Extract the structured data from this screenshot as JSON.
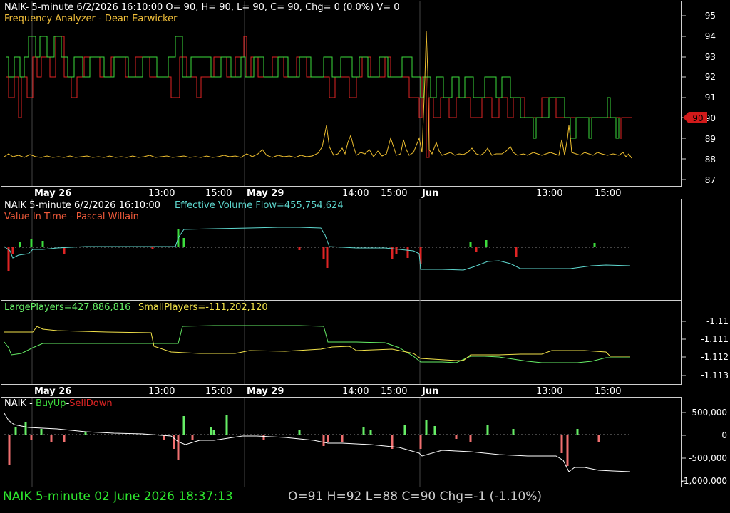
{
  "colors": {
    "background": "#000000",
    "frame": "#cfcfcf",
    "grid": "#3a3a3a",
    "axis_text": "#ffffff",
    "white": "#ffffff",
    "yellow": "#f2e24a",
    "orange_yellow": "#f0c030",
    "green": "#3ddc3d",
    "red": "#e02424",
    "cyan": "#5fd9d0",
    "light_green": "#66ee66",
    "salmon": "#f07070",
    "price_tag": "#d11a1a",
    "status_green": "#2ee62e",
    "status_gray": "#cfcfcf"
  },
  "panel1": {
    "header_line1": "NAIK- 5-minute 6/2/2026 16:10:00 O= 90, H= 90, L= 90, C= 90, Chg= 0 (0.0%) V= 0",
    "header_line2": "Frequency Analyzer - Dean Earwicker",
    "y_ticks": [
      "95",
      "94",
      "93",
      "92",
      "91",
      "90",
      "89",
      "88",
      "87"
    ],
    "last_price": "90"
  },
  "time_axis": {
    "labels": [
      "May 26",
      "13:00",
      "15:00",
      "May 29",
      "14:00",
      "15:00",
      "Jun",
      "13:00",
      "15:00"
    ]
  },
  "panel2": {
    "title": "NAIK 5-minute  6/2/2026 16:10:00",
    "indicator": "Effective Volume Flow=455,754,624",
    "subtitle": "Value In Time - Pascal Willain"
  },
  "panel3": {
    "large": "LargePlayers=427,886,816",
    "small": "SmallPlayers=-111,202,120",
    "y_ticks": [
      "-1.11",
      "-1.111",
      "-1.112",
      "-1.113"
    ]
  },
  "panel4": {
    "title_prefix": "NAIK - ",
    "buy": "BuyUp",
    "dash": "-",
    "sell": "SellDown",
    "y_ticks": [
      "500,000",
      "0",
      "-500,000",
      "-1,000,000"
    ]
  },
  "status": {
    "left": "NAIK  5-minute   02 June 2026 18:37:13",
    "right": "O=91  H=92  L=88  C=90  Chg=-1 (-1.10%)"
  }
}
